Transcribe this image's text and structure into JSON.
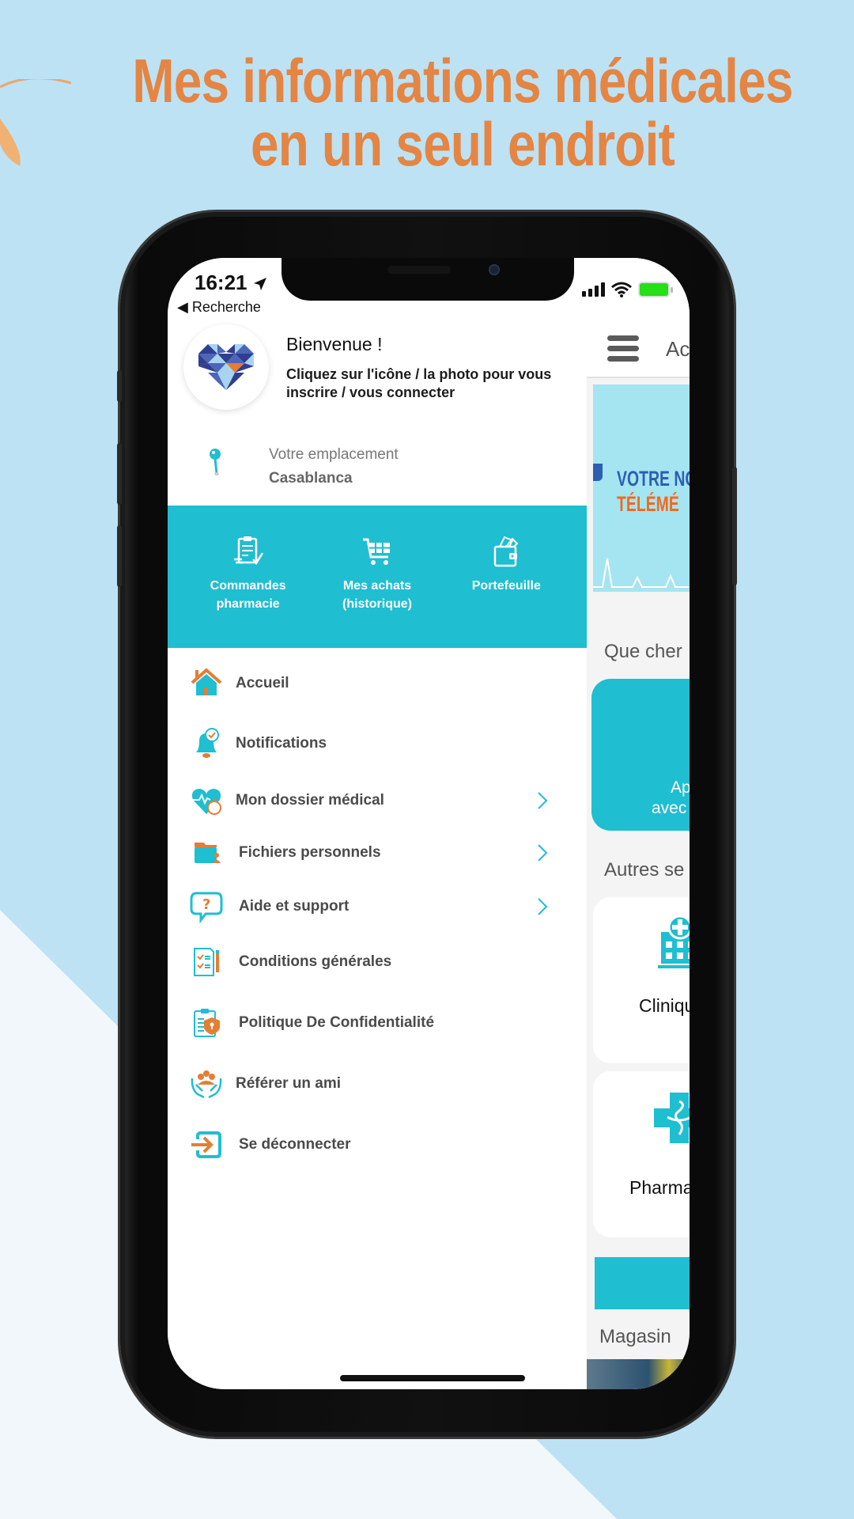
{
  "promo": {
    "headline_line1": "Mes informations médicales",
    "headline_line2": "en un seul endroit"
  },
  "status_bar": {
    "time": "16:21",
    "back_label": "◀ Recherche"
  },
  "drawer": {
    "welcome_title": "Bienvenue !",
    "welcome_subtitle": "Cliquez sur l'icône / la photo pour vous inscrire / vous connecter",
    "location_label": "Votre emplacement",
    "location_value": "Casablanca",
    "quick_actions": [
      {
        "label": "Commandes pharmacie",
        "icon": "prescription-clipboard-icon"
      },
      {
        "label": "Mes achats (historique)",
        "icon": "shopping-cart-icon"
      },
      {
        "label": "Portefeuille",
        "icon": "wallet-icon"
      }
    ],
    "menu": [
      {
        "label": "Accueil",
        "icon": "home-icon",
        "has_chevron": false
      },
      {
        "label": "Notifications",
        "icon": "bell-icon",
        "has_chevron": false
      },
      {
        "label": "Mon dossier médical",
        "icon": "heart-health-icon",
        "has_chevron": true
      },
      {
        "label": "Fichiers personnels",
        "icon": "folder-user-icon",
        "has_chevron": true
      },
      {
        "label": "Aide et support",
        "icon": "help-bubble-icon",
        "has_chevron": true
      },
      {
        "label": "Conditions générales",
        "icon": "checklist-document-icon",
        "has_chevron": false
      },
      {
        "label": "Politique De Confidentialité",
        "icon": "privacy-shield-icon",
        "has_chevron": false
      },
      {
        "label": "Référer un ami",
        "icon": "refer-friends-icon",
        "has_chevron": false
      },
      {
        "label": "Se déconnecter",
        "icon": "logout-icon",
        "has_chevron": false
      }
    ]
  },
  "background_page": {
    "header_title": "Ac",
    "banner_line1": "VOTRE NO",
    "banner_line2": "TÉLÉMÉ",
    "section1_title": "Que cher",
    "card_text_line1": "Ap",
    "card_text_line2": "avec",
    "section2_title": "Autres se",
    "service1_label": "Cliniqu",
    "service2_label": "Pharma",
    "section3_title": "Magasin"
  },
  "colors": {
    "accent_teal": "#1fbed1",
    "accent_orange": "#e48544",
    "background": "#bde2f4"
  }
}
